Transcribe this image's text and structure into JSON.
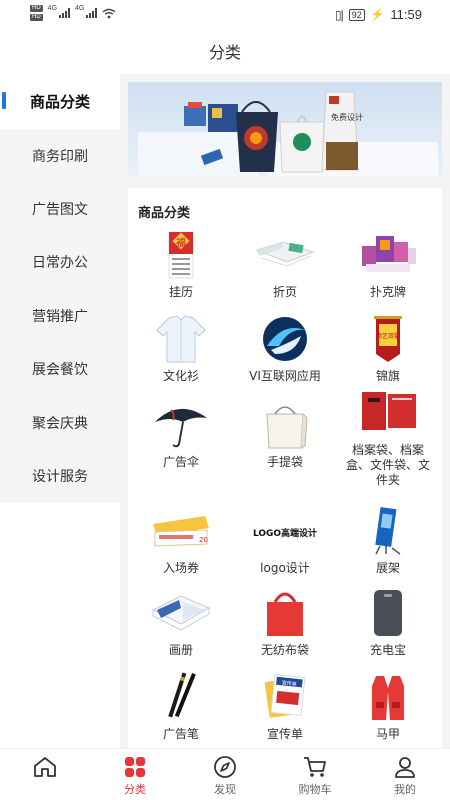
{
  "status_bar": {
    "hd1": "HD",
    "hd2": "HD",
    "net1": "4G",
    "net2": "4G",
    "battery": "92",
    "time": "11:59"
  },
  "header": {
    "title": "分类"
  },
  "sidebar": {
    "items": [
      {
        "label": "商品分类",
        "active": true
      },
      {
        "label": "商务印刷"
      },
      {
        "label": "广告图文"
      },
      {
        "label": "日常办公"
      },
      {
        "label": "营销推广"
      },
      {
        "label": "展会餐饮"
      },
      {
        "label": "聚会庆典"
      },
      {
        "label": "设计服务"
      }
    ]
  },
  "banner": {
    "bag_text": "免费设计"
  },
  "section": {
    "title": "商品分类",
    "products": [
      {
        "label": "挂历",
        "icon": "calendar-icon"
      },
      {
        "label": "折页",
        "icon": "folded-leaflet-icon"
      },
      {
        "label": "扑克牌",
        "icon": "playing-cards-icon"
      },
      {
        "label": "文化衫",
        "icon": "shirt-icon"
      },
      {
        "label": "VI互联网应用",
        "icon": "vi-logo-icon"
      },
      {
        "label": "锦旗",
        "icon": "pennant-icon"
      },
      {
        "label": "广告伞",
        "icon": "umbrella-icon"
      },
      {
        "label": "手提袋",
        "icon": "handbag-icon"
      },
      {
        "label": "档案袋、档案盒、文件袋、文件夹",
        "icon": "file-folder-icon"
      },
      {
        "label": "入场券",
        "icon": "ticket-icon"
      },
      {
        "label": "logo设计",
        "icon": "logo-design-icon"
      },
      {
        "label": "展架",
        "icon": "display-stand-icon"
      },
      {
        "label": "画册",
        "icon": "brochure-icon"
      },
      {
        "label": "无纺布袋",
        "icon": "nonwoven-bag-icon"
      },
      {
        "label": "充电宝",
        "icon": "power-bank-icon"
      },
      {
        "label": "广告笔",
        "icon": "pen-icon"
      },
      {
        "label": "宣传单",
        "icon": "flyer-icon"
      },
      {
        "label": "马甲",
        "icon": "vest-icon"
      }
    ]
  },
  "thumb_text": {
    "calendar_fu": "福",
    "pennant_text": "德艺双馨",
    "ticket_text": "20",
    "logo_text": "LOGO高端设计",
    "flyer_text": "宣传单"
  },
  "tabbar": {
    "tabs": [
      {
        "label": "",
        "icon": "home-icon"
      },
      {
        "label": "分类",
        "icon": "category-grid-icon",
        "active": true
      },
      {
        "label": "发现",
        "icon": "compass-icon"
      },
      {
        "label": "购物车",
        "icon": "cart-icon"
      },
      {
        "label": "我的",
        "icon": "profile-icon"
      }
    ]
  },
  "colors": {
    "accent": "#e6363a",
    "sidebar_indicator": "#1a73e8",
    "sidebar_bg": "#f5f5f5",
    "main_bg": "#f4f4f4"
  }
}
